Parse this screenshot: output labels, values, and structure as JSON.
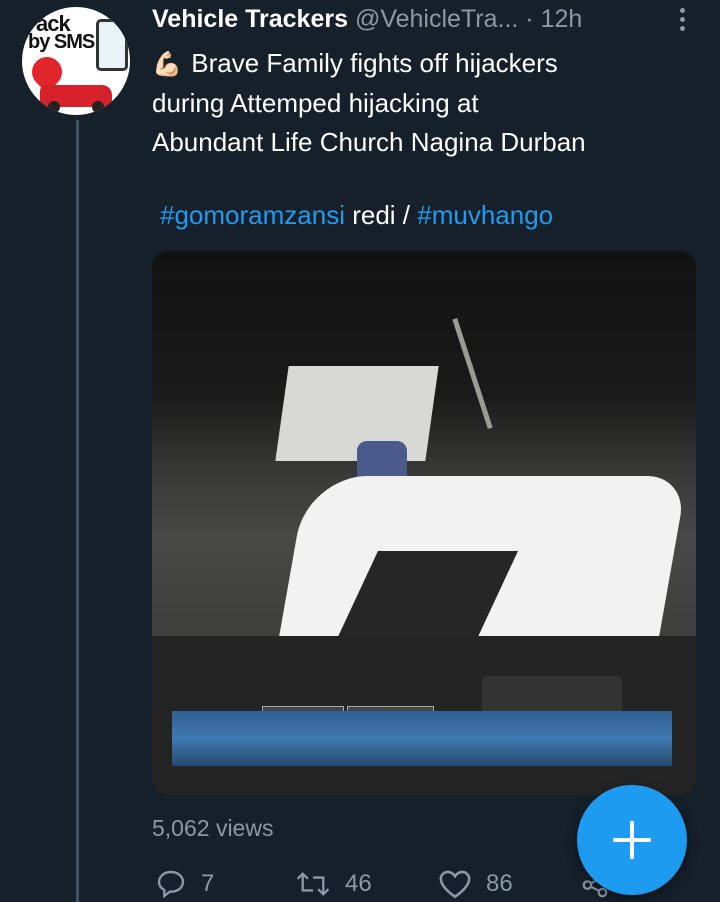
{
  "tweet": {
    "author": {
      "display_name": "Vehicle Trackers",
      "handle": "@VehicleTra...",
      "separator": "·",
      "time": "12h",
      "avatar_text_1": "ack",
      "avatar_text_2": "by SMS"
    },
    "text_lines": [
      "Brave Family fights off hijackers",
      "during Attemped hijacking at",
      "Abundant Life Church Nagina Durban"
    ],
    "emoji": "💪🏻",
    "hashtag_1": "#gomoramzansi",
    "middle_text": " redi / ",
    "hashtag_2": "#muvhango",
    "views": "5,062 views",
    "actions": {
      "replies": "7",
      "retweets": "46",
      "likes": "86"
    }
  },
  "colors": {
    "background": "#15202b",
    "accent": "#1d9bf0",
    "muted": "#8b98a5"
  },
  "icons": [
    "more-vertical-icon",
    "reply-icon",
    "retweet-icon",
    "like-icon",
    "share-icon",
    "compose-plus-icon"
  ]
}
